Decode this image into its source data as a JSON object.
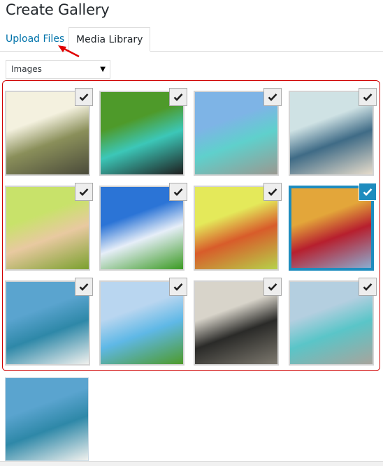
{
  "header": {
    "title": "Create Gallery"
  },
  "tabs": [
    {
      "label": "Upload Files",
      "active": false
    },
    {
      "label": "Media Library",
      "active": true
    }
  ],
  "filter": {
    "selected": "Images"
  },
  "annotation": {
    "color": "#e00000"
  },
  "colors": {
    "selection_border": "#1e8cbe",
    "link": "#0073aa",
    "highlight_box": "#d00000"
  },
  "media_items": [
    {
      "name": "forest-meditation",
      "checked": true,
      "selected": false,
      "colors": [
        "#f4f1df",
        "#8a8f5a",
        "#4a4a3a"
      ]
    },
    {
      "name": "grass-breathing-yoga",
      "checked": true,
      "selected": false,
      "colors": [
        "#4e9a2a",
        "#3cc7b8",
        "#1e1e1e"
      ]
    },
    {
      "name": "pier-tree-pose",
      "checked": true,
      "selected": false,
      "colors": [
        "#7eb4e6",
        "#5fd0cc",
        "#9a9890"
      ]
    },
    {
      "name": "beach-girl-birds",
      "checked": true,
      "selected": false,
      "colors": [
        "#cfe2e4",
        "#3f6b86",
        "#e7dccb"
      ]
    },
    {
      "name": "woman-in-grass",
      "checked": true,
      "selected": false,
      "colors": [
        "#c8e26a",
        "#e8c9a0",
        "#7aa02e"
      ]
    },
    {
      "name": "couple-jumping",
      "checked": true,
      "selected": false,
      "colors": [
        "#2b74d6",
        "#e6eef8",
        "#3a9a22"
      ]
    },
    {
      "name": "woman-reading",
      "checked": true,
      "selected": false,
      "colors": [
        "#e4e95a",
        "#d85c2a",
        "#b6d24a"
      ]
    },
    {
      "name": "autumn-couple",
      "checked": true,
      "selected": true,
      "colors": [
        "#e3a63a",
        "#b71f2e",
        "#8cacd0"
      ]
    },
    {
      "name": "arms-raised-beach",
      "checked": true,
      "selected": false,
      "colors": [
        "#5aa4cf",
        "#2e88a8",
        "#f1f1ee"
      ]
    },
    {
      "name": "arms-raised-grass",
      "checked": true,
      "selected": false,
      "colors": [
        "#b9d6f0",
        "#5fb8e6",
        "#4e9a2a"
      ]
    },
    {
      "name": "man-in-chair",
      "checked": true,
      "selected": false,
      "colors": [
        "#d8d4ca",
        "#2a2a28",
        "#7c786e"
      ]
    },
    {
      "name": "pier-yoga-ocean",
      "checked": true,
      "selected": false,
      "colors": [
        "#b4cfe0",
        "#5ac5c8",
        "#a8a49c"
      ]
    }
  ],
  "standalone_item": {
    "name": "arms-raised-beach-preview",
    "colors": [
      "#5aa4cf",
      "#2e88a8",
      "#f1f1ee"
    ]
  }
}
